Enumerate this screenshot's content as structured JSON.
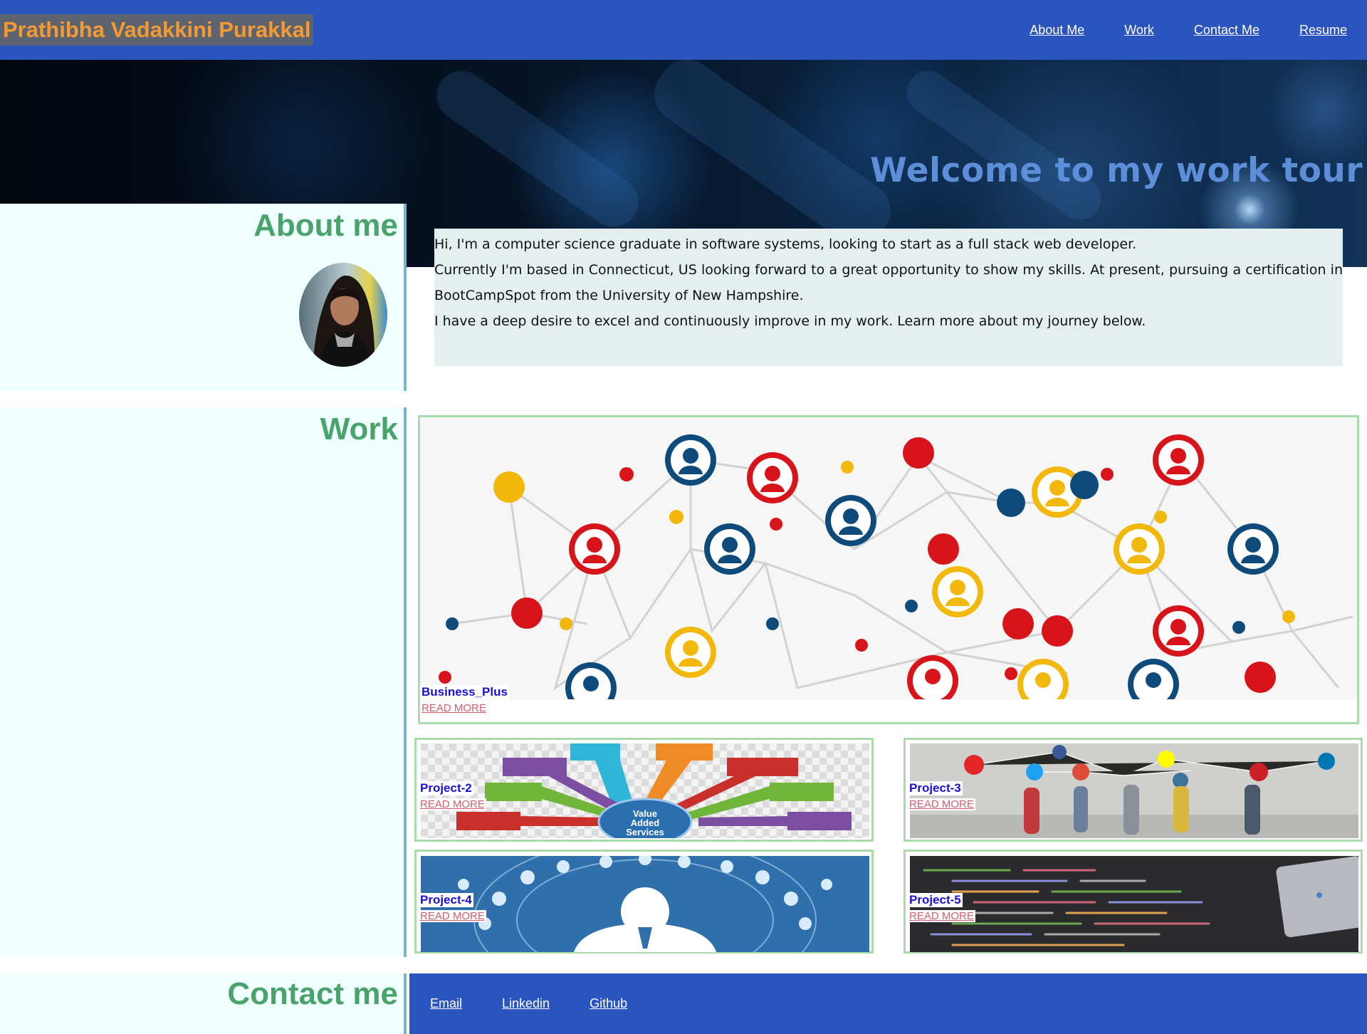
{
  "header": {
    "brand": "Prathibha Vadakkini Purakkal",
    "nav": [
      "About Me",
      "Work",
      "Contact Me",
      "Resume"
    ]
  },
  "hero": {
    "title": "Welcome to my work tour"
  },
  "about": {
    "heading": "About me",
    "paragraphs": [
      "Hi, I'm a computer science graduate in software systems, looking to start as a full stack web developer.",
      "Currently I'm based in Connecticut, US looking forward to a great opportunity to show my skills. At present, pursuing a certification in BootCampSpot from the University of New Hampshire.",
      "I have a deep desire to excel and continuously improve in my work. Learn more about my journey below."
    ]
  },
  "work": {
    "heading": "Work",
    "projects": [
      {
        "title": "Business_Plus",
        "link": "READ MORE"
      },
      {
        "title": "Project-2",
        "link": "READ MORE"
      },
      {
        "title": "Project-3",
        "link": "READ MORE"
      },
      {
        "title": "Project-4",
        "link": "READ MORE"
      },
      {
        "title": "Project-5",
        "link": "READ MORE"
      }
    ],
    "project2_image_labels": [
      "Value",
      "Added",
      "Services"
    ]
  },
  "contact": {
    "heading": "Contact me",
    "links": [
      "Email",
      "Linkedin",
      "Github"
    ]
  },
  "colors": {
    "header_bg": "#2b55be",
    "brand_text": "#f39a34",
    "heading_green": "#4aa36b",
    "panel_bg": "#f0ffff",
    "card_border": "#a8dcaa",
    "project_title": "#1a0fd6",
    "read_more": "#d05f6e"
  }
}
